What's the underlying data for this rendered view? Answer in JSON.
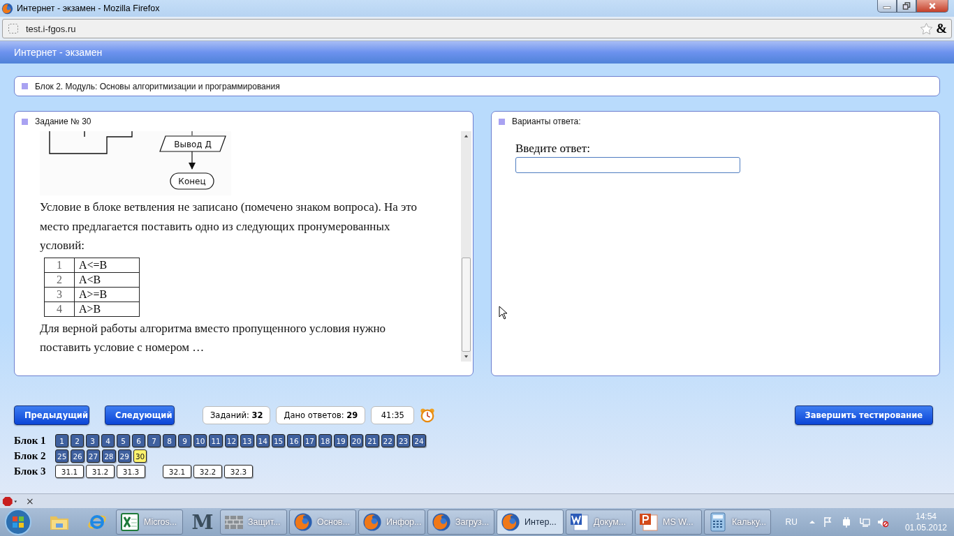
{
  "window": {
    "title": "Интернет - экзамен - Mozilla Firefox"
  },
  "address_bar": {
    "url": "test.i-fgos.ru",
    "extension_glyph": "&"
  },
  "page_header": {
    "title": "Интернет - экзамен"
  },
  "module": {
    "title": "Блок 2. Модуль: Основы алгоритмизации и программирования"
  },
  "task": {
    "heading": "Задание № 30",
    "flowchart": {
      "output_label": "Вывод Д",
      "end_label": "Конец"
    },
    "intro": "Условие в блоке ветвления не записано (помечено знаком вопроса). На это место предлагается поставить одно из следующих пронумерованных условий:",
    "conditions": [
      {
        "number": "1",
        "condition": "A<=B"
      },
      {
        "number": "2",
        "condition": "A<B"
      },
      {
        "number": "3",
        "condition": "A>=B"
      },
      {
        "number": "4",
        "condition": "A>B"
      }
    ],
    "question": "Для верной работы алгоритма вместо пропущенного условия нужно поставить условие с номером …"
  },
  "answer": {
    "heading": "Варианты ответа:",
    "prompt": "Введите ответ:"
  },
  "controls": {
    "previous": "Предыдущий",
    "next": "Следующий",
    "tasks_count": "Заданий: **32**",
    "answers_count": "Дано ответов: **29**",
    "timer": "41:35",
    "finish": "Завершить тестирование"
  },
  "blocks": [
    {
      "label": "Блок 1",
      "groups": [
        [
          {
            "label": "1",
            "answered": true,
            "selected": false
          },
          {
            "label": "2",
            "answered": true,
            "selected": false
          },
          {
            "label": "3",
            "answered": true,
            "selected": false
          },
          {
            "label": "4",
            "answered": true,
            "selected": false
          },
          {
            "label": "5",
            "answered": true,
            "selected": false
          },
          {
            "label": "6",
            "answered": true,
            "selected": false
          },
          {
            "label": "7",
            "answered": true,
            "selected": false
          },
          {
            "label": "8",
            "answered": true,
            "selected": false
          },
          {
            "label": "9",
            "answered": true,
            "selected": false
          },
          {
            "label": "10",
            "answered": true,
            "selected": false
          },
          {
            "label": "11",
            "answered": true,
            "selected": false
          },
          {
            "label": "12",
            "answered": true,
            "selected": false
          },
          {
            "label": "13",
            "answered": true,
            "selected": false
          },
          {
            "label": "14",
            "answered": true,
            "selected": false
          },
          {
            "label": "15",
            "answered": true,
            "selected": false
          },
          {
            "label": "16",
            "answered": true,
            "selected": false
          },
          {
            "label": "17",
            "answered": true,
            "selected": false
          },
          {
            "label": "18",
            "answered": true,
            "selected": false
          },
          {
            "label": "19",
            "answered": true,
            "selected": false
          },
          {
            "label": "20",
            "answered": true,
            "selected": false
          },
          {
            "label": "21",
            "answered": true,
            "selected": false
          },
          {
            "label": "22",
            "answered": true,
            "selected": false
          },
          {
            "label": "23",
            "answered": true,
            "selected": false
          },
          {
            "label": "24",
            "answered": true,
            "selected": false
          }
        ]
      ]
    },
    {
      "label": "Блок 2",
      "groups": [
        [
          {
            "label": "25",
            "answered": true,
            "selected": false
          },
          {
            "label": "26",
            "answered": true,
            "selected": false
          },
          {
            "label": "27",
            "answered": true,
            "selected": false
          },
          {
            "label": "28",
            "answered": true,
            "selected": false
          },
          {
            "label": "29",
            "answered": true,
            "selected": false
          },
          {
            "label": "30",
            "answered": false,
            "selected": true
          }
        ]
      ]
    },
    {
      "label": "Блок 3",
      "groups": [
        [
          {
            "label": "31.1",
            "answered": false,
            "selected": false
          },
          {
            "label": "31.2",
            "answered": false,
            "selected": false
          },
          {
            "label": "31.3",
            "answered": false,
            "selected": false
          }
        ],
        [
          {
            "label": "32.1",
            "answered": false,
            "selected": false
          },
          {
            "label": "32.2",
            "answered": false,
            "selected": false
          },
          {
            "label": "32.3",
            "answered": false,
            "selected": false
          }
        ]
      ]
    }
  ],
  "addon_bar": {
    "close": "×"
  },
  "taskbar": {
    "items": [
      {
        "kind": "folder",
        "selected": false
      },
      {
        "kind": "ie",
        "selected": false
      },
      {
        "kind": "excel",
        "label": "Micros...",
        "selected": false
      },
      {
        "kind": "letter",
        "label": "M",
        "selected": false
      },
      {
        "kind": "wall",
        "label": "Защит...",
        "selected": false
      },
      {
        "kind": "firefox",
        "label": "Основ...",
        "selected": false
      },
      {
        "kind": "firefox",
        "label": "Инфор...",
        "selected": false
      },
      {
        "kind": "firefox",
        "label": "Загруз...",
        "selected": false
      },
      {
        "kind": "firefox",
        "label": "Интер...",
        "selected": true
      },
      {
        "kind": "word",
        "label": "Докум...",
        "selected": false
      },
      {
        "kind": "ppt",
        "label": "MS W...",
        "selected": false
      },
      {
        "kind": "calc",
        "label": "Кальку...",
        "selected": false
      }
    ],
    "language": "RU",
    "time": "14:54",
    "date": "01.05.2012"
  }
}
